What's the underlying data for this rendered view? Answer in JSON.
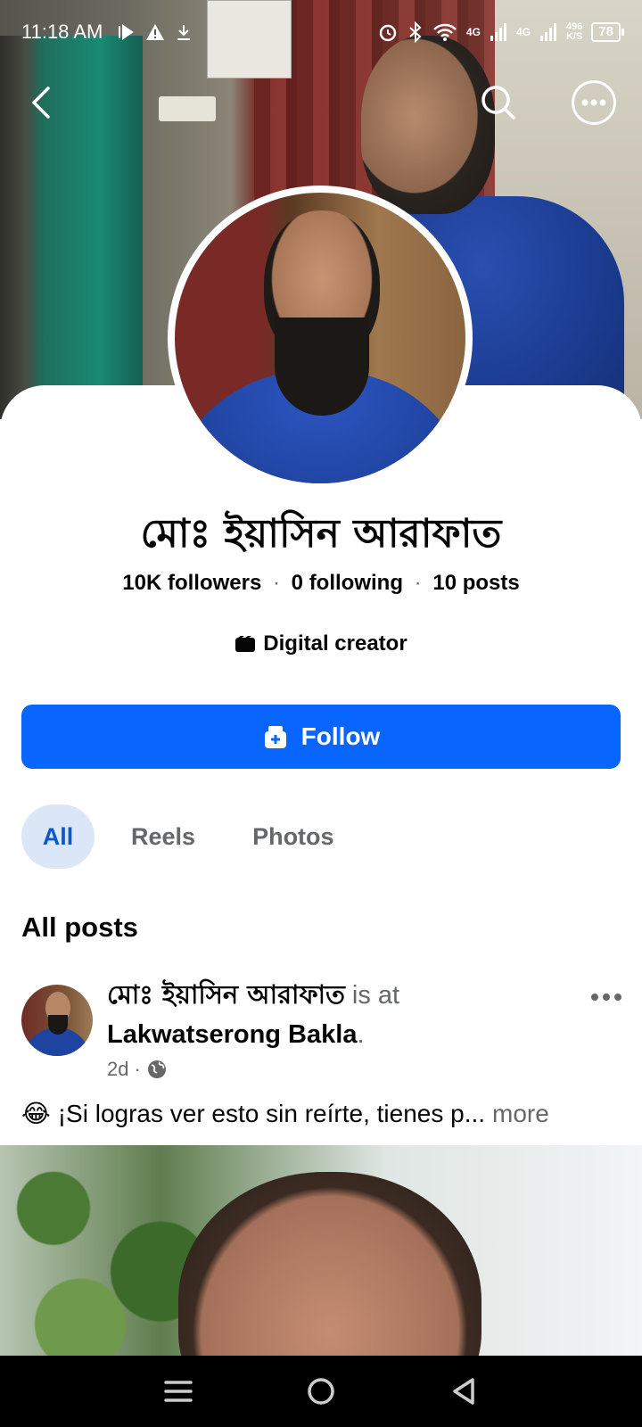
{
  "status_bar": {
    "time": "11:18 AM",
    "net_speed_value": "496",
    "net_speed_unit": "K/S",
    "battery": "78",
    "network_labels": [
      "4G",
      "4G"
    ]
  },
  "profile": {
    "name": "মোঃ ইয়াসিন আরাফাত",
    "followers": "10K followers",
    "following": "0 following",
    "posts": "10 posts",
    "separator": "·",
    "category": "Digital creator",
    "follow_label": "Follow"
  },
  "tabs": [
    {
      "label": "All",
      "active": true
    },
    {
      "label": "Reels",
      "active": false
    },
    {
      "label": "Photos",
      "active": false
    }
  ],
  "section_title": "All posts",
  "post": {
    "author": "মোঃ ইয়াসিন আরাফাত",
    "is_at": "is at",
    "place": "Lakwatserong Bakla",
    "period": ".",
    "time": "2d",
    "meta_separator": "·",
    "privacy_icon": "globe-icon",
    "emoji": "😂",
    "text": "¡Si logras ver esto sin reírte, tienes p...",
    "more_label": "more"
  },
  "icons": {
    "back": "back-arrow-icon",
    "search": "search-icon",
    "more": "more-options-icon",
    "follow": "follow-user-icon",
    "category": "clapperboard-icon"
  },
  "colors": {
    "accent": "#0866ff",
    "tab_active_bg": "#dbe7f7",
    "tab_active_text": "#0a58ca",
    "secondary_text": "#65676b"
  }
}
